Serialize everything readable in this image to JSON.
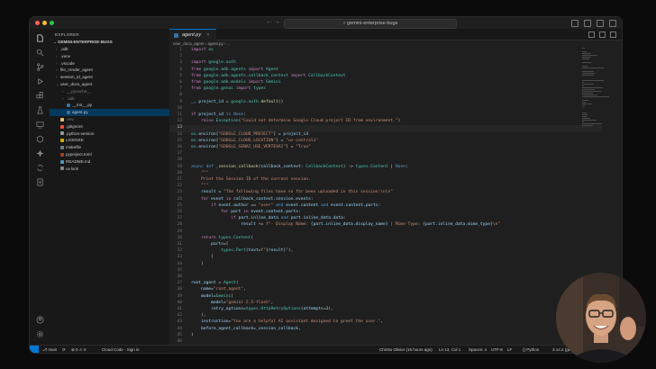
{
  "window": {
    "search": "gemini-enterprise-bugs",
    "nav_back": "←",
    "nav_forward": "→"
  },
  "sidebar": {
    "title": "EXPLORER",
    "root": "GEMINI-ENTERPRISE-BUGS",
    "items": [
      {
        "label": ".adk",
        "indent": 1,
        "chev": "›",
        "icon": "folder"
      },
      {
        "label": ".venv",
        "indent": 1,
        "chev": "›",
        "icon": "folder"
      },
      {
        "label": ".vscode",
        "indent": 1,
        "chev": "›",
        "icon": "folder"
      },
      {
        "label": "file_render_agent",
        "indent": 1,
        "chev": "›",
        "icon": "folder"
      },
      {
        "label": "session_id_agent",
        "indent": 1,
        "chev": "›",
        "icon": "folder"
      },
      {
        "label": "user_docs_agent",
        "indent": 1,
        "chev": "⌄",
        "icon": "folder"
      },
      {
        "label": "__pycache__",
        "indent": 2,
        "chev": "›",
        "icon": "folder",
        "muted": true
      },
      {
        "label": ".adk",
        "indent": 2,
        "chev": "›",
        "icon": "folder",
        "muted": true
      },
      {
        "label": "__init__.py",
        "indent": 2,
        "chev": "",
        "icon": "py"
      },
      {
        "label": "agent.py",
        "indent": 2,
        "chev": "",
        "icon": "py",
        "selected": true
      },
      {
        "label": ".env",
        "indent": 1,
        "chev": "",
        "icon": "env",
        "muted": true
      },
      {
        "label": ".gitignore",
        "indent": 1,
        "chev": "",
        "icon": "git"
      },
      {
        "label": ".python-version",
        "indent": 1,
        "chev": "",
        "icon": "file"
      },
      {
        "label": "LICENSE",
        "indent": 1,
        "chev": "",
        "icon": "lic"
      },
      {
        "label": "makefile",
        "indent": 1,
        "chev": "",
        "icon": "make"
      },
      {
        "label": "pyproject.toml",
        "indent": 1,
        "chev": "",
        "icon": "toml"
      },
      {
        "label": "README.md",
        "indent": 1,
        "chev": "",
        "icon": "md"
      },
      {
        "label": "uv.lock",
        "indent": 1,
        "chev": "",
        "icon": "lock"
      }
    ],
    "outline": "OUTLINE",
    "timeline": "TIMELINE"
  },
  "editor": {
    "tab": "agent.py",
    "tab_close": "×",
    "breadcrumb": "user_docs_agent  ›  agent.py  ›  ...",
    "current_line": 13
  },
  "code": [
    [
      [
        "import ",
        "kw2"
      ],
      [
        "os",
        "cls"
      ]
    ],
    [],
    [
      [
        "import ",
        "kw2"
      ],
      [
        "google.auth",
        "cls"
      ]
    ],
    [
      [
        "from ",
        "kw2"
      ],
      [
        "google.adk.agents ",
        "cls"
      ],
      [
        "import ",
        "kw2"
      ],
      [
        "Agent",
        "cls"
      ]
    ],
    [
      [
        "from ",
        "kw2"
      ],
      [
        "google.adk.agents.callback_context ",
        "cls"
      ],
      [
        "import ",
        "kw2"
      ],
      [
        "CallbackContext",
        "cls"
      ]
    ],
    [
      [
        "from ",
        "kw2"
      ],
      [
        "google.adk.models ",
        "cls"
      ],
      [
        "import ",
        "kw2"
      ],
      [
        "Gemini",
        "cls"
      ]
    ],
    [
      [
        "from ",
        "kw2"
      ],
      [
        "google.genai ",
        "cls"
      ],
      [
        "import ",
        "kw2"
      ],
      [
        "types",
        "cls"
      ]
    ],
    [],
    [
      [
        "_, ",
        "var"
      ],
      [
        "project_id ",
        "var"
      ],
      [
        "= ",
        ""
      ],
      [
        "google.auth.",
        "cls"
      ],
      [
        "default",
        "fn"
      ],
      [
        "()",
        ""
      ]
    ],
    [],
    [
      [
        "if ",
        "kw2"
      ],
      [
        "project_id ",
        "var"
      ],
      [
        "is ",
        "kw"
      ],
      [
        "None",
        "kw"
      ],
      [
        ":",
        ""
      ]
    ],
    [
      [
        "    raise ",
        "kw2"
      ],
      [
        "Exception",
        "cls"
      ],
      [
        "(",
        ""
      ],
      [
        "\"Could not determine Google Cloud project ID from environment.\"",
        "str"
      ],
      [
        ")",
        ""
      ]
    ],
    [],
    [
      [
        "os",
        "cls"
      ],
      [
        ".",
        ""
      ],
      [
        "environ",
        "var"
      ],
      [
        "[",
        ""
      ],
      [
        "\"GOOGLE_CLOUD_PROJECT\"",
        "str"
      ],
      [
        "] = ",
        ""
      ],
      [
        "project_id",
        "var"
      ]
    ],
    [
      [
        "os",
        "cls"
      ],
      [
        ".",
        ""
      ],
      [
        "environ",
        "var"
      ],
      [
        "[",
        ""
      ],
      [
        "\"GOOGLE_CLOUD_LOCATION\"",
        "str"
      ],
      [
        "] = ",
        ""
      ],
      [
        "\"us-central1\"",
        "str"
      ]
    ],
    [
      [
        "os",
        "cls"
      ],
      [
        ".",
        ""
      ],
      [
        "environ",
        "var"
      ],
      [
        "[",
        ""
      ],
      [
        "\"GOOGLE_GENAI_USE_VERTEXAI\"",
        "str"
      ],
      [
        "] = ",
        ""
      ],
      [
        "\"True\"",
        "str"
      ]
    ],
    [],
    [],
    [
      [
        "async def ",
        "kw"
      ],
      [
        "_session_callback",
        "fn"
      ],
      [
        "(",
        ""
      ],
      [
        "callback_context",
        "var"
      ],
      [
        ": ",
        ""
      ],
      [
        "CallbackContext",
        "cls"
      ],
      [
        ") -> ",
        ""
      ],
      [
        "types",
        "cls"
      ],
      [
        ".",
        ""
      ],
      [
        "Content ",
        "cls"
      ],
      [
        "| ",
        ""
      ],
      [
        "None",
        "kw"
      ],
      [
        ":",
        ""
      ]
    ],
    [
      [
        "    \"\"\"",
        "dstr"
      ]
    ],
    [
      [
        "    Print the Session ID of the current session.",
        "dstr"
      ]
    ],
    [
      [
        "    \"\"\"",
        "dstr"
      ]
    ],
    [
      [
        "    result ",
        "var"
      ],
      [
        "= ",
        ""
      ],
      [
        "\"The following files have so far been uploaded in this session:\\n\\n\"",
        "str"
      ]
    ],
    [
      [
        "    for ",
        "kw2"
      ],
      [
        "event ",
        "var"
      ],
      [
        "in ",
        "kw2"
      ],
      [
        "callback_context",
        "var"
      ],
      [
        ".",
        ""
      ],
      [
        "session",
        "var"
      ],
      [
        ".",
        ""
      ],
      [
        "events",
        "var"
      ],
      [
        ":",
        ""
      ]
    ],
    [
      [
        "        if ",
        "kw2"
      ],
      [
        "event",
        "var"
      ],
      [
        ".",
        ""
      ],
      [
        "author ",
        "var"
      ],
      [
        "== ",
        ""
      ],
      [
        "\"user\" ",
        "str"
      ],
      [
        "and ",
        "kw"
      ],
      [
        "event",
        "var"
      ],
      [
        ".",
        ""
      ],
      [
        "content ",
        "var"
      ],
      [
        "and ",
        "kw"
      ],
      [
        "event",
        "var"
      ],
      [
        ".",
        ""
      ],
      [
        "content",
        "var"
      ],
      [
        ".",
        ""
      ],
      [
        "parts",
        "var"
      ],
      [
        ":",
        ""
      ]
    ],
    [
      [
        "            for ",
        "kw2"
      ],
      [
        "part ",
        "var"
      ],
      [
        "in ",
        "kw2"
      ],
      [
        "event",
        "var"
      ],
      [
        ".",
        ""
      ],
      [
        "content",
        "var"
      ],
      [
        ".",
        ""
      ],
      [
        "parts",
        "var"
      ],
      [
        ":",
        ""
      ]
    ],
    [
      [
        "                if ",
        "kw2"
      ],
      [
        "part",
        "var"
      ],
      [
        ".",
        ""
      ],
      [
        "inline_data ",
        "var"
      ],
      [
        "and ",
        "kw"
      ],
      [
        "part",
        "var"
      ],
      [
        ".",
        ""
      ],
      [
        "inline_data",
        "var"
      ],
      [
        ".",
        ""
      ],
      [
        "data",
        "var"
      ],
      [
        ":",
        ""
      ]
    ],
    [
      [
        "                    result ",
        "var"
      ],
      [
        "+= ",
        ""
      ],
      [
        "f\"- Display Name: ",
        "str"
      ],
      [
        "{part.inline_data.display_name}",
        "var"
      ],
      [
        " | Mime Type: ",
        "str"
      ],
      [
        "{part.inline_data.mime_type}",
        "var"
      ],
      [
        "\\n\"",
        "str"
      ]
    ],
    [],
    [
      [
        "    return ",
        "kw2"
      ],
      [
        "types",
        "cls"
      ],
      [
        ".",
        ""
      ],
      [
        "Content",
        "cls"
      ],
      [
        "(",
        ""
      ]
    ],
    [
      [
        "        parts",
        "var"
      ],
      [
        "=[",
        ""
      ]
    ],
    [
      [
        "            types",
        "cls"
      ],
      [
        ".",
        ""
      ],
      [
        "Part",
        "cls"
      ],
      [
        "(",
        ""
      ],
      [
        "text",
        "var"
      ],
      [
        "=",
        ""
      ],
      [
        "f\"",
        "str"
      ],
      [
        "{result}",
        "var"
      ],
      [
        "\"",
        "str"
      ],
      [
        "),",
        ""
      ]
    ],
    [
      [
        "        ]",
        ""
      ]
    ],
    [
      [
        "    )",
        ""
      ]
    ],
    [],
    [],
    [
      [
        "root_agent ",
        "var"
      ],
      [
        "= ",
        ""
      ],
      [
        "Agent",
        "cls"
      ],
      [
        "(",
        ""
      ]
    ],
    [
      [
        "    name",
        "var"
      ],
      [
        "=",
        ""
      ],
      [
        "\"root_agent\"",
        "str"
      ],
      [
        ",",
        ""
      ]
    ],
    [
      [
        "    model",
        "var"
      ],
      [
        "=",
        ""
      ],
      [
        "Gemini",
        "cls"
      ],
      [
        "(",
        ""
      ]
    ],
    [
      [
        "        model",
        "var"
      ],
      [
        "=",
        ""
      ],
      [
        "\"gemini-2.5-flash\"",
        "str"
      ],
      [
        ",",
        ""
      ]
    ],
    [
      [
        "        retry_options",
        "var"
      ],
      [
        "=",
        ""
      ],
      [
        "types",
        "cls"
      ],
      [
        ".",
        ""
      ],
      [
        "HttpRetryOptions",
        "cls"
      ],
      [
        "(",
        ""
      ],
      [
        "attempts",
        "var"
      ],
      [
        "=",
        ""
      ],
      [
        "3",
        "num"
      ],
      [
        "),",
        ""
      ]
    ],
    [
      [
        "    ),",
        ""
      ]
    ],
    [
      [
        "    instruction",
        "var"
      ],
      [
        "=",
        ""
      ],
      [
        "\"You are a helpful AI assistant designed to greet the user.\"",
        "str"
      ],
      [
        ",",
        ""
      ]
    ],
    [
      [
        "    before_agent_callback",
        "var"
      ],
      [
        "=",
        ""
      ],
      [
        "_session_callback",
        "var"
      ],
      [
        ",",
        ""
      ]
    ],
    [
      [
        ")",
        ""
      ]
    ],
    []
  ],
  "status": {
    "branch": "main",
    "sync": "⟳",
    "problems": "⊗ 0  ⚠ 0",
    "cloud": "Cloud Code - Sign in",
    "blame": "Christo Olivier (15 hours ago)",
    "cursor": "Ln 13, Col 1",
    "spaces": "Spaces: 4",
    "encoding": "UTF-8",
    "eol": "LF",
    "language": "{} Python",
    "python_version": "3.14.2 (gemini"
  },
  "colors": {
    "accent": "#0078d4",
    "selection": "#04395e",
    "editor_bg": "#1f1f1f"
  }
}
